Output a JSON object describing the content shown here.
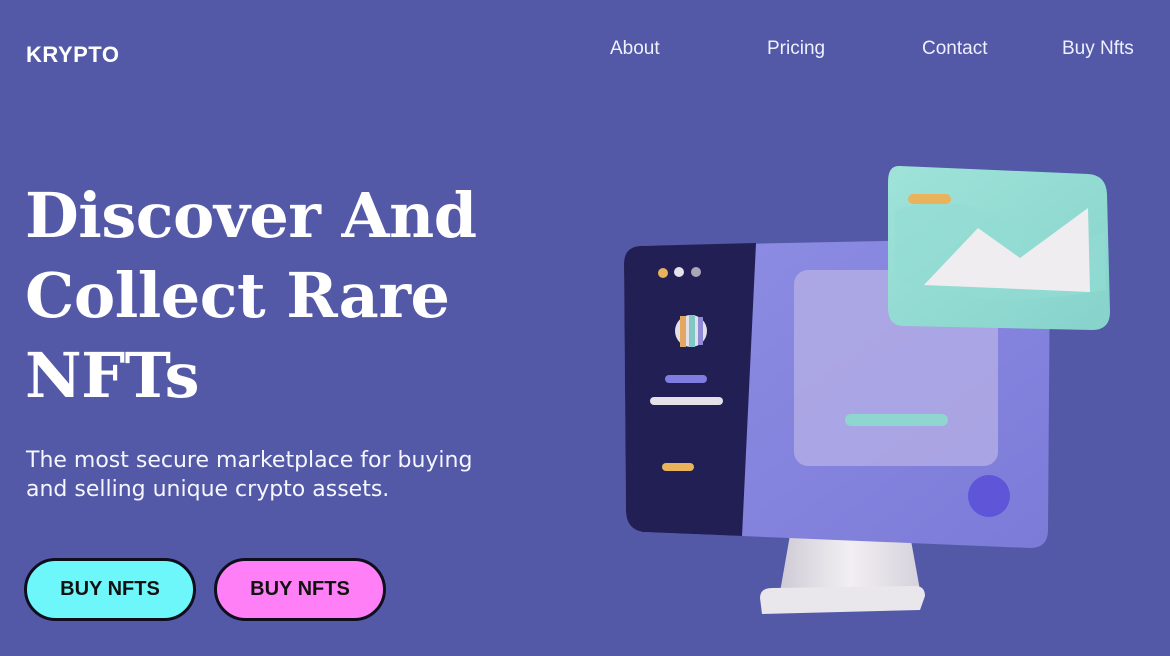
{
  "brand": {
    "name": "KRYPTO"
  },
  "nav": {
    "about": "About",
    "pricing": "Pricing",
    "contact": "Contact",
    "buy": "Buy Nfts"
  },
  "hero": {
    "title_line1": "Discover And",
    "title_line2": "Collect Rare",
    "title_line3": "NFTs",
    "subtitle_line1": "The most secure marketplace for buying",
    "subtitle_line2": "and selling unique crypto assets."
  },
  "buttons": {
    "primary": "BUY NFTS",
    "secondary": "BUY NFTS"
  },
  "colors": {
    "background": "#5359a6",
    "primary_button": "#6ef7fb",
    "secondary_button": "#ff7ff7"
  },
  "illustration": {
    "icon": "computer-monitor-icon"
  }
}
